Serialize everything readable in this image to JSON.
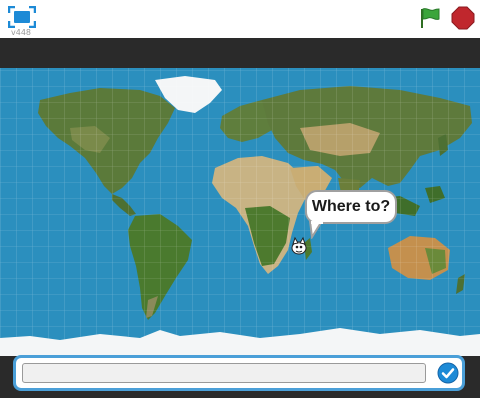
{
  "header": {
    "version": "v448",
    "fullscreen_icon": "fullscreen-icon",
    "green_flag_icon": "green-flag-icon",
    "stop_icon": "stop-icon"
  },
  "stage": {
    "speech_bubble": "Where to?",
    "sprite_icon": "cat-sprite-icon"
  },
  "ask_prompt": {
    "input_value": "",
    "submit_icon": "check-icon"
  },
  "colors": {
    "ocean": "#2b8fbe",
    "land": "#5b7a3a",
    "desert": "#c8b384",
    "ice": "#ffffff",
    "ask_border": "#4a9fd8",
    "flag": "#3ba53b",
    "stop": "#c0272d"
  }
}
